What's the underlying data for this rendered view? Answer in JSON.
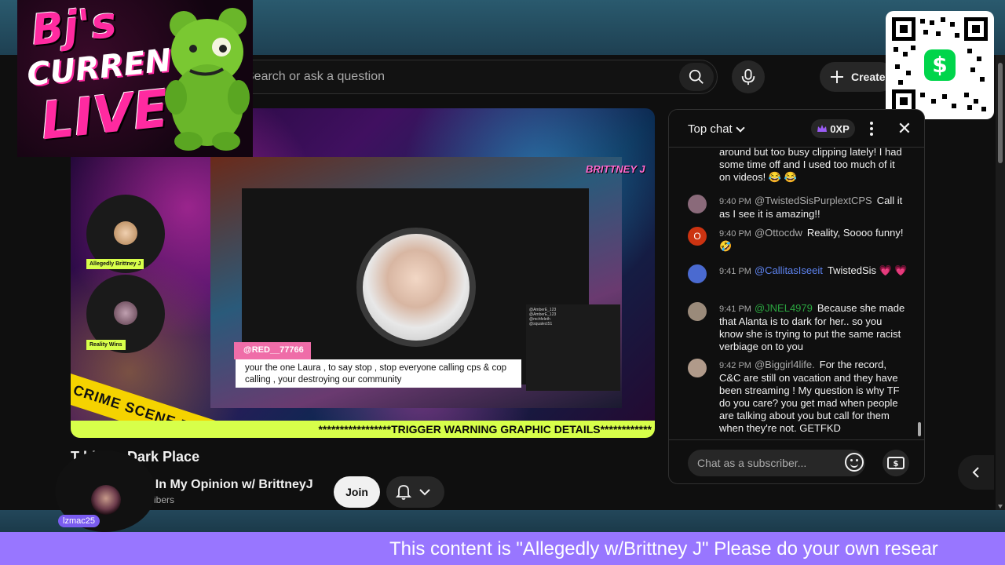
{
  "search": {
    "placeholder": "Search or ask a question"
  },
  "header": {
    "create_label": "Create"
  },
  "overlay": {
    "logo_line1": "Bj's",
    "logo_line2": "CURRENT",
    "logo_line3": "LIVE"
  },
  "video": {
    "brand": "BRITTNEY J",
    "guest1_label": "Allegedly Brittney J",
    "guest2_label": "Reality Wins",
    "handle_tag": "@RED__77766",
    "comment": "your the one Laura , to say stop , stop everyone calling cps & cop calling , your destroying our community",
    "crime_tape": "CRIME SCENE DO N",
    "warning": "*****************TRIGGER WARNING GRAPHIC DETAILS************",
    "mini_chat": [
      "@AmberE_123",
      "@AmberE_123",
      "@mchfeleth",
      "@squalect51"
    ]
  },
  "title": "T        ld is a Dark Place",
  "channel": {
    "name": "ly In My Opinion w/ BrittneyJ",
    "subscribers": "scribers",
    "join_label": "Join",
    "overlay_user": "lzmac25"
  },
  "chat": {
    "mode": "Top chat",
    "xp": "0XP",
    "messages": [
      {
        "time": "",
        "author": "",
        "text": "around but too busy clipping lately! I had some time off and I used too much of it on videos! 😂 😂",
        "color": "#555"
      },
      {
        "time": "9:40 PM",
        "author": "@TwistedSisPurplextCPS",
        "text": "Call it as I see it is amazing!!",
        "color": "#8a6a7a"
      },
      {
        "time": "9:40 PM",
        "author": "@Ottocdw",
        "text": "Reality, Soooo funny! 🤣",
        "color": "#cc3311"
      },
      {
        "time": "9:41 PM",
        "author": "@CallitasIseeit",
        "text": "TwistedSis 💗 💗",
        "color": "#4a6ad0"
      },
      {
        "time": "9:41 PM",
        "author": "@JNEL4979",
        "text": "Because she made that Alanta is to dark for her.. so you know she is trying to put the same racist verbiage on to you",
        "color": "#9a8a7a"
      },
      {
        "time": "9:42 PM",
        "author": "@Biggirl4life.",
        "text": "For the record, C&C are still on vacation and they have been streaming ! My question is why TF do you care? you get mad when people are talking about you but call for them when they're not. GETFKD",
        "color": "#b09a8a"
      }
    ],
    "input_placeholder": "Chat as a subscriber..."
  },
  "ticker": "This content is \"Allegedly w/Brittney J\" Please do your own resear",
  "colors": {
    "accent": "#9876ff",
    "warning": "#d7ff4a",
    "member": "#2ba640"
  }
}
